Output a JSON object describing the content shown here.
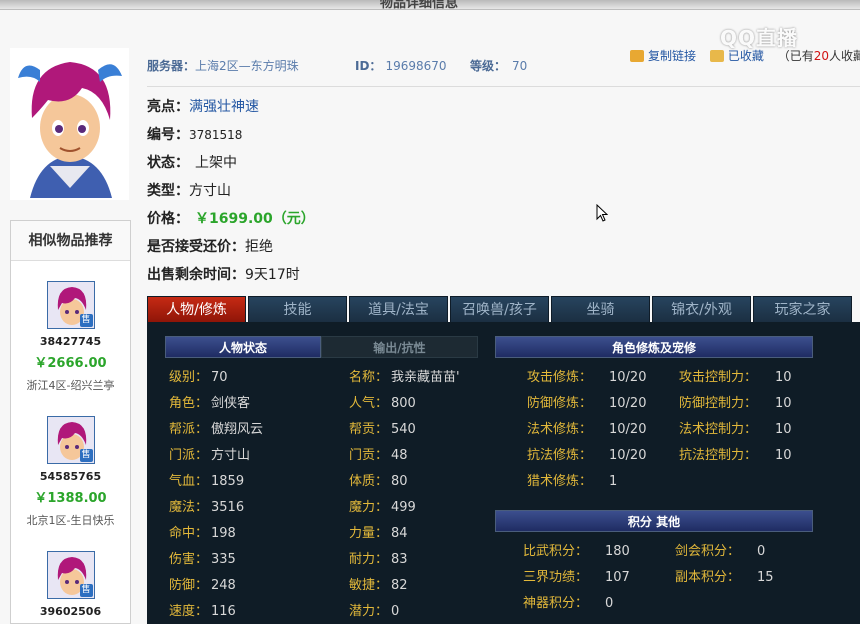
{
  "header": {
    "title": "物品详细信息",
    "server_label": "服务器：",
    "server_value": "上海2区—东方明珠",
    "id_label": "ID：",
    "id_value": "19698670",
    "level_label": "等级：",
    "level_value": "70",
    "copy_link": "复制链接",
    "collected": "已收藏",
    "collect_prefix": "（已有",
    "collect_count": "20",
    "collect_suffix": "人收藏",
    "watermark": "QQ直播"
  },
  "details": {
    "highlight_label": "亮点：",
    "highlight_value": "满强壮神速",
    "number_label": "编号：",
    "number_value": "3781518",
    "status_label": "状态：",
    "status_value": "上架中",
    "type_label": "类型：",
    "type_value": "方寸山",
    "price_label": "价格：",
    "price_value": "￥1699.00（元）",
    "counter_label": "是否接受还价：",
    "counter_value": "拒绝",
    "remain_label": "出售剩余时间：",
    "remain_value": "9天17时"
  },
  "similar": {
    "title": "相似物品推荐",
    "sell_badge": "售",
    "items": [
      {
        "id": "38427745",
        "price": "￥2666.00",
        "server": "浙江4区-绍兴兰亭"
      },
      {
        "id": "54585765",
        "price": "￥1388.00",
        "server": "北京1区-生日快乐"
      },
      {
        "id": "39602506"
      }
    ]
  },
  "tabs": [
    "人物/修炼",
    "技能",
    "道具/法宝",
    "召唤兽/孩子",
    "坐骑",
    "锦衣/外观",
    "玩家之家"
  ],
  "panel": {
    "char_state": "人物状态",
    "output_resist": "输出/抗性",
    "cultivation_head": "角色修炼及宠修",
    "score_head": "积分 其他",
    "left_col": [
      {
        "label": "级别：",
        "value": "70"
      },
      {
        "label": "角色：",
        "value": "剑侠客"
      },
      {
        "label": "帮派：",
        "value": "傲翔风云"
      },
      {
        "label": "门派：",
        "value": "方寸山"
      },
      {
        "label": "气血：",
        "value": "1859"
      },
      {
        "label": "魔法：",
        "value": "3516"
      },
      {
        "label": "命中：",
        "value": "198"
      },
      {
        "label": "伤害：",
        "value": "335"
      },
      {
        "label": "防御：",
        "value": "248"
      },
      {
        "label": "速度：",
        "value": "116"
      }
    ],
    "right_col": [
      {
        "label": "名称：",
        "value": "我亲藏苗苗'"
      },
      {
        "label": "人气：",
        "value": "800"
      },
      {
        "label": "帮贡：",
        "value": "540"
      },
      {
        "label": "门贡：",
        "value": "48"
      },
      {
        "label": "体质：",
        "value": "80"
      },
      {
        "label": "魔力：",
        "value": "499"
      },
      {
        "label": "力量：",
        "value": "84"
      },
      {
        "label": "耐力：",
        "value": "83"
      },
      {
        "label": "敏捷：",
        "value": "82"
      },
      {
        "label": "潜力：",
        "value": "0"
      }
    ],
    "cultivation": [
      {
        "label": "攻击修炼：",
        "value": "10/20",
        "label2": "攻击控制力：",
        "value2": "10"
      },
      {
        "label": "防御修炼：",
        "value": "10/20",
        "label2": "防御控制力：",
        "value2": "10"
      },
      {
        "label": "法术修炼：",
        "value": "10/20",
        "label2": "法术控制力：",
        "value2": "10"
      },
      {
        "label": "抗法修炼：",
        "value": "10/20",
        "label2": "抗法控制力：",
        "value2": "10"
      },
      {
        "label": "猎术修炼：",
        "value": "1"
      }
    ],
    "scores": [
      {
        "label": "比武积分：",
        "value": "180",
        "label2": "剑会积分：",
        "value2": "0"
      },
      {
        "label": "三界功绩：",
        "value": "107",
        "label2": "副本积分：",
        "value2": "15"
      },
      {
        "label": "神器积分：",
        "value": "0"
      }
    ]
  }
}
